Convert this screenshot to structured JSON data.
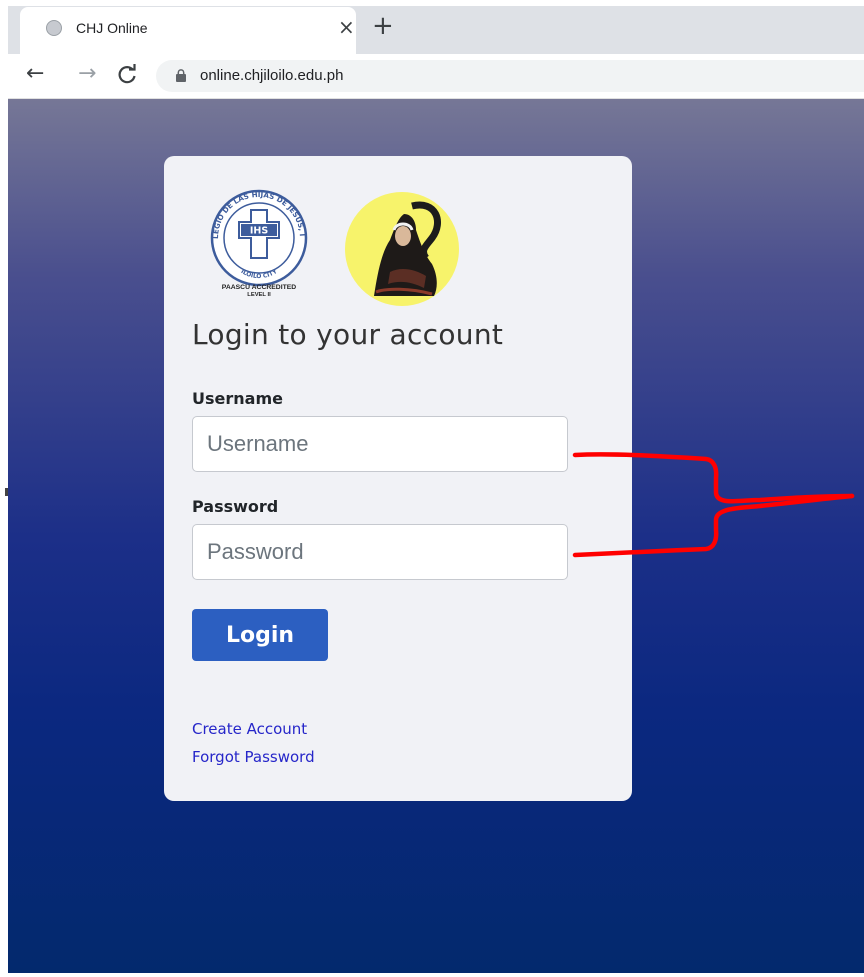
{
  "browser": {
    "tab_title": "CHJ Online",
    "tab_close": "×",
    "new_tab": "+",
    "back": "←",
    "forward": "→",
    "reload": "C",
    "url": "online.chjiloilo.edu.ph"
  },
  "seal": {
    "outer_text": "COLEGIO DE LAS HIJAS DE JESUS, INC.",
    "city": "ILOILO CITY",
    "monogram": "IHS",
    "accreditation_line1": "PAASCU ACCREDITED",
    "accreditation_line2": "LEVEL II"
  },
  "login": {
    "title": "Login to your account",
    "username_label": "Username",
    "username_placeholder": "Username",
    "password_label": "Password",
    "password_placeholder": "Password",
    "submit_label": "Login"
  },
  "links": {
    "create_account": "Create Account",
    "forgot_password": "Forgot Password"
  },
  "colors": {
    "brand_button": "#2c5fc1",
    "link": "#2626c9",
    "annotation": "#ff0000",
    "portrait_bg": "#f7f36b"
  }
}
